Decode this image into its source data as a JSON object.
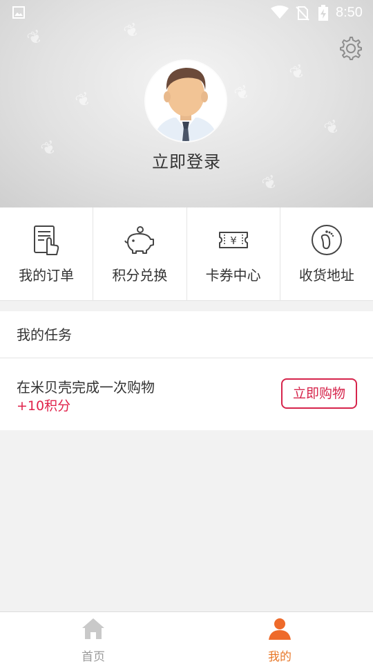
{
  "status_bar": {
    "time": "8:50",
    "icons": [
      "gallery-icon",
      "wifi-icon",
      "no-sim-icon",
      "battery-charging-icon"
    ]
  },
  "header": {
    "settings_icon": "gear-icon",
    "avatar": "default-male-avatar",
    "login_label": "立即登录"
  },
  "shortcuts": [
    {
      "label": "我的订单",
      "icon": "order-list-icon"
    },
    {
      "label": "积分兑换",
      "icon": "piggy-bank-icon"
    },
    {
      "label": "卡券中心",
      "icon": "coupon-ticket-icon"
    },
    {
      "label": "收货地址",
      "icon": "footprint-icon"
    }
  ],
  "tasks": {
    "title": "我的任务",
    "items": [
      {
        "name": "在米贝壳完成一次购物",
        "points": "+10积分",
        "action": "立即购物"
      }
    ]
  },
  "tabbar": [
    {
      "label": "首页",
      "icon": "home-icon",
      "active": false
    },
    {
      "label": "我的",
      "icon": "person-icon",
      "active": true
    }
  ],
  "colors": {
    "accent_red": "#d6244b",
    "points_red": "#e0224a",
    "active_tab_orange": "#e8782a",
    "inactive_tab_gray": "#9a9a9a"
  }
}
